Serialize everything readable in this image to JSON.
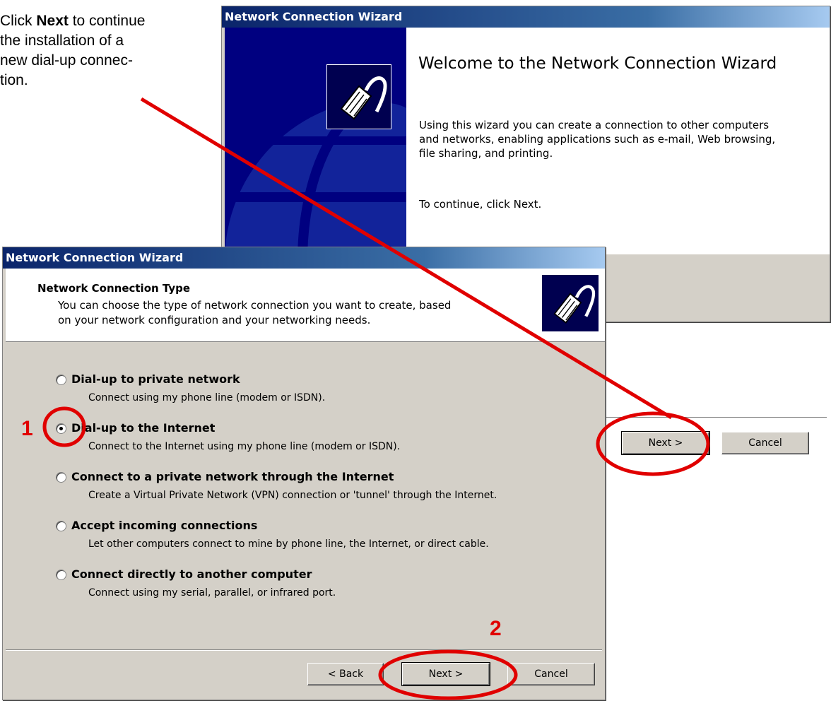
{
  "instructions": {
    "line1_pre": "Click ",
    "line1_bold": "Next",
    "line1_post": " to continue",
    "line2": "the installation of a",
    "line3": "new dial-up connec-",
    "line4": "tion."
  },
  "welcome_window": {
    "title": "Network Connection Wizard",
    "heading": "Welcome to the Network Connection Wizard",
    "body": "Using this wizard you can create a connection to other computers and networks, enabling applications such as e-mail, Web browsing, file sharing, and printing.",
    "continue_text": "To continue, click Next.",
    "next_label": "Next >",
    "cancel_label": "Cancel",
    "icon": "network-cable-icon"
  },
  "type_window": {
    "title": "Network Connection Wizard",
    "header_title": "Network Connection Type",
    "header_desc": "You can choose the type of network connection you want to create, based on your network configuration and your networking needs.",
    "icon": "network-cable-icon",
    "options": [
      {
        "label": "Dial-up to private network",
        "desc": "Connect using my phone line (modem or ISDN).",
        "checked": false
      },
      {
        "label": "Dial-up to the Internet",
        "desc": "Connect to the Internet using my phone line (modem or ISDN).",
        "checked": true
      },
      {
        "label": "Connect to a private network through the Internet",
        "desc": "Create a Virtual Private Network (VPN) connection or 'tunnel' through the Internet.",
        "checked": false
      },
      {
        "label": "Accept incoming connections",
        "desc": "Let other computers connect to mine by phone line, the Internet, or direct cable.",
        "checked": false
      },
      {
        "label": "Connect directly to another computer",
        "desc": "Connect using my serial, parallel, or infrared port.",
        "checked": false
      }
    ],
    "back_label": "< Back",
    "next_label": "Next >",
    "cancel_label": "Cancel"
  },
  "annotations": {
    "step1": "1",
    "step2": "2",
    "accent_color": "#e00000"
  }
}
